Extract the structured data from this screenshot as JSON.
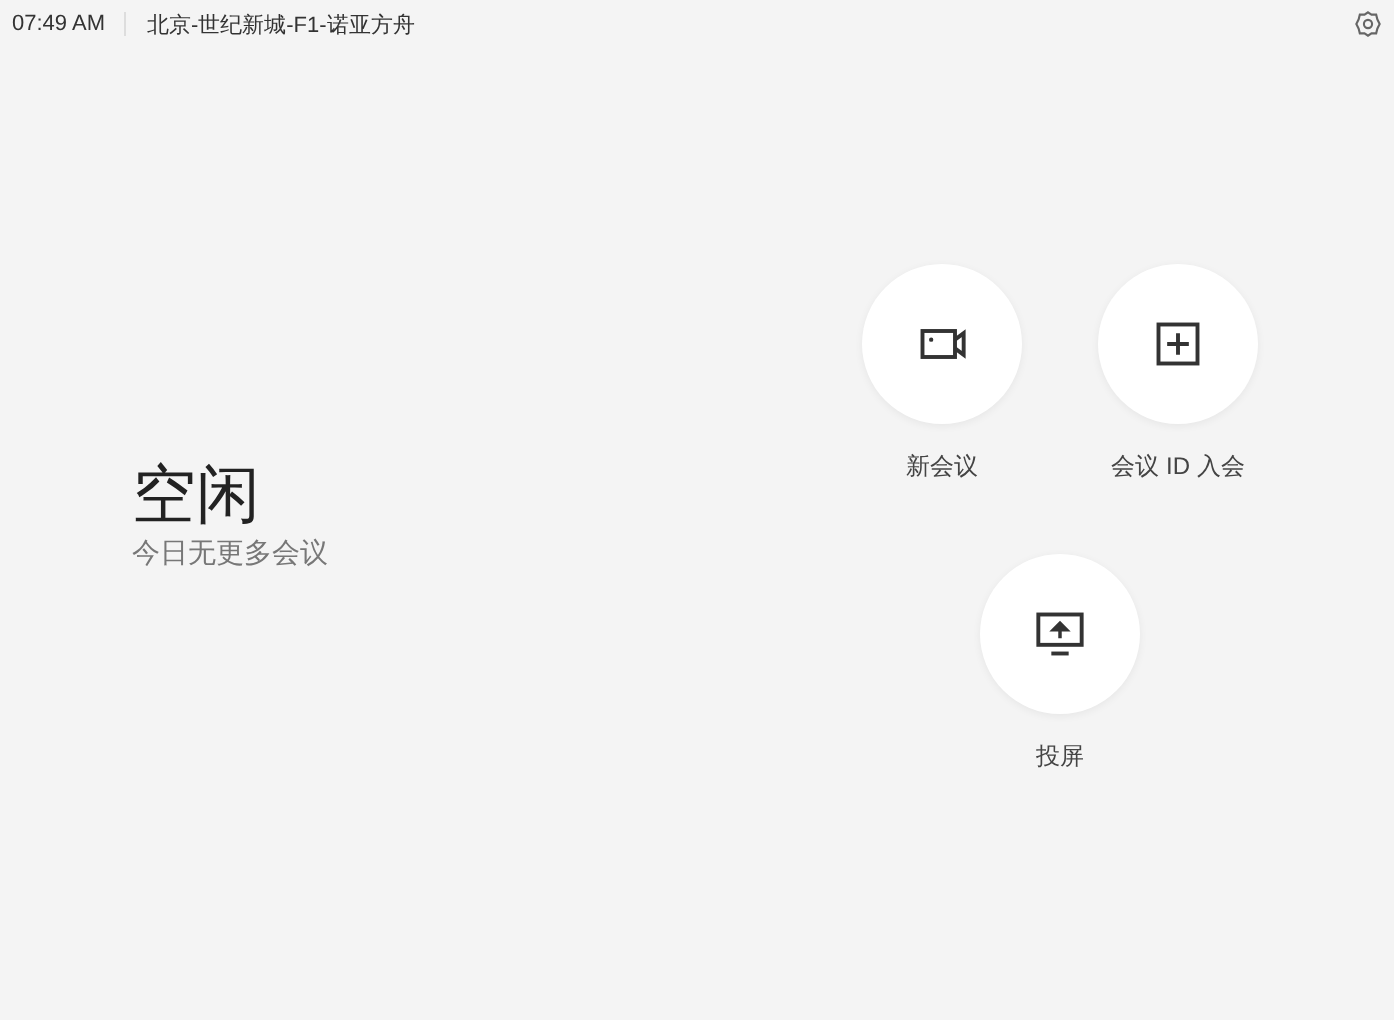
{
  "status_bar": {
    "time": "07:49 AM",
    "room": "北京-世纪新城-F1-诺亚方舟"
  },
  "status": {
    "title": "空闲",
    "subtitle": "今日无更多会议"
  },
  "actions": [
    {
      "kind": "new-meeting",
      "label": "新会议"
    },
    {
      "kind": "join",
      "label": "会议 ID 入会"
    },
    {
      "kind": "share-screen",
      "label": "投屏"
    }
  ]
}
